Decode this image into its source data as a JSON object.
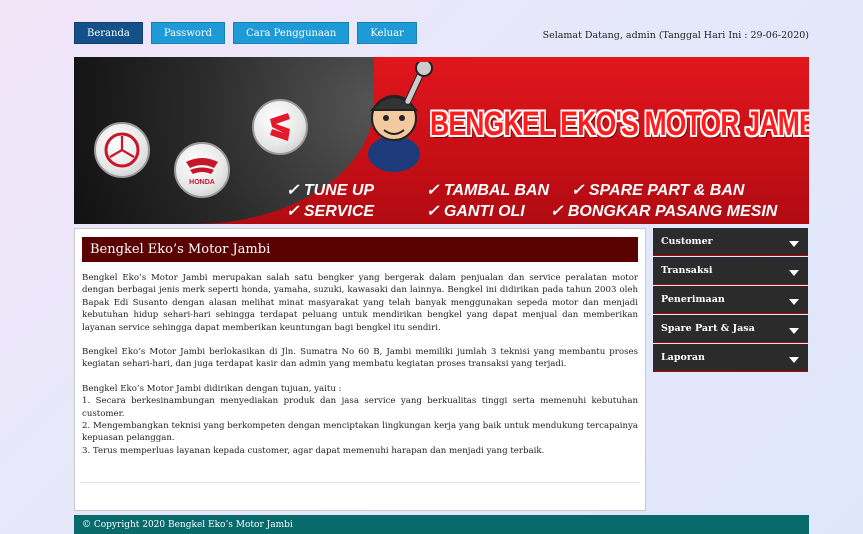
{
  "nav": {
    "items": [
      {
        "label": "Beranda",
        "active": true
      },
      {
        "label": "Password",
        "active": false
      },
      {
        "label": "Cara Penggunaan",
        "active": false
      },
      {
        "label": "Keluar",
        "active": false
      }
    ]
  },
  "welcome_text": "Selamat Datang, admin (Tanggal Hari Ini : 29-06-2020)",
  "banner": {
    "title": "BENGKEL EKO'S MOTOR JAMBI",
    "honda_label": "HONDA",
    "services": {
      "tune_up": "✓ TUNE UP",
      "tambal_ban": "✓ TAMBAL BAN",
      "spare_part": "✓ SPARE PART & BAN",
      "service": "✓ SERVICE",
      "ganti_oli": "✓ GANTI OLI",
      "bongkar": "✓ BONGKAR PASANG MESIN"
    }
  },
  "content": {
    "title": "Bengkel Eko’s Motor Jambi",
    "para1": "Bengkel Eko’s Motor Jambi merupakan salah satu bengker yang bergerak dalam penjualan dan service peralatan motor dengan berbagai jenis merk seperti honda, yamaha, suzuki, kawasaki dan lainnya. Bengkel ini didirikan pada tahun 2003 oleh Bapak Edi Susanto dengan alasan melihat minat masyarakat yang telah banyak menggunakan sepeda motor dan menjadi kebutuhan hidup sehari-hari sehingga terdapat peluang untuk mendirikan bengkel yang dapat menjual dan memberikan layanan service sehingga dapat memberikan keuntungan bagi bengkel itu sendiri.",
    "para2": "Bengkel Eko’s Motor Jambi berlokasikan di Jln. Sumatra No 60 B, Jambi memiliki jumlah 3 teknisi yang membantu proses kegiatan sehari-hari, dan juga terdapat kasir dan admin yang membatu kegiatan proses transaksi yang terjadi.",
    "goals_intro": "Bengkel Eko’s Motor Jambi didirikan dengan tujuan, yaitu :",
    "goals": [
      "1. Secara berkesinambungan menyediakan produk dan jasa service yang berkualitas tinggi serta memenuhi kebutuhan customer.",
      "2. Mengembangkan teknisi yang berkompeten dengan menciptakan lingkungan kerja yang baik untuk mendukung tercapainya kepuasan pelanggan.",
      "3. Terus memperluas layanan kepada customer, agar dapat memenuhi harapan dan menjadi yang terbaik."
    ]
  },
  "sidebar": {
    "items": [
      {
        "label": "Customer"
      },
      {
        "label": "Transaksi"
      },
      {
        "label": "Penerimaan"
      },
      {
        "label": "Spare Part & Jasa"
      },
      {
        "label": "Laporan"
      }
    ]
  },
  "footer": "© Copyright 2020 Bengkel Eko’s Motor Jambi"
}
